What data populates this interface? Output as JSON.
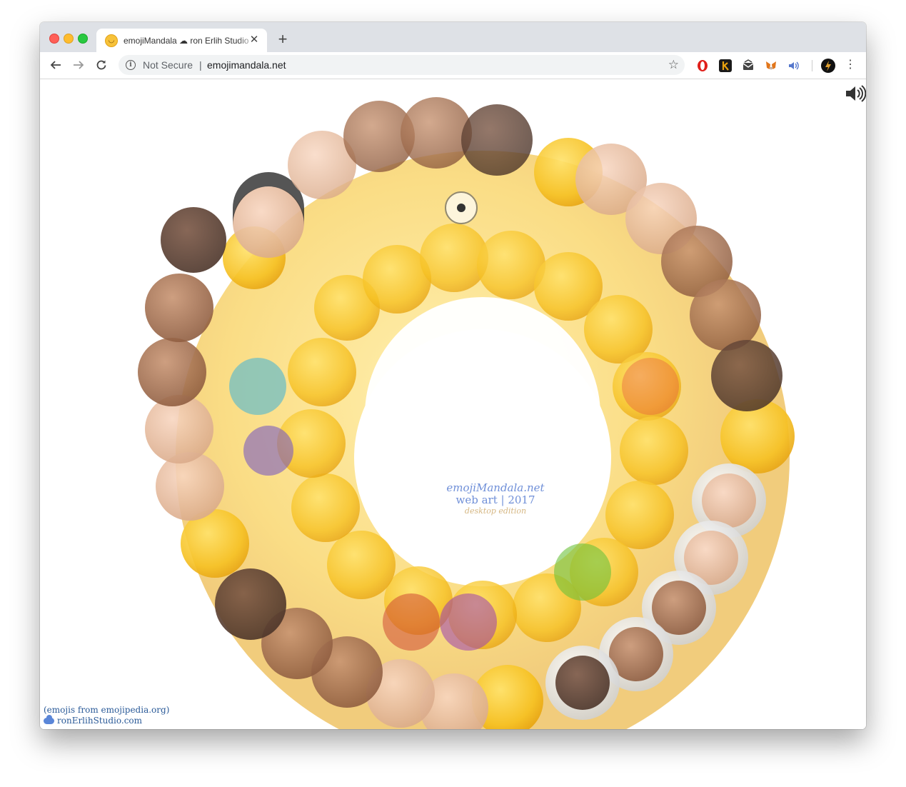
{
  "browser": {
    "tab": {
      "title": "emojiMandala ☁ ron Erlih Studio",
      "favicon": "smiling-face-icon",
      "close_glyph": "✕"
    },
    "new_tab_glyph": "+",
    "omnibox": {
      "security_label": "Not Secure",
      "separator": "|",
      "url": "emojimandala.net"
    },
    "toolbar_icons": [
      "back-arrow-icon",
      "forward-arrow-icon",
      "reload-icon",
      "info-icon",
      "bookmark-star-icon"
    ],
    "extensions": [
      "opera-icon",
      "k-extension-icon",
      "mail-extension-icon",
      "metamask-fox-icon",
      "sound-extension-icon"
    ],
    "menu_glyph": "⋮"
  },
  "page": {
    "credit": {
      "line1": "emojiMandala.net",
      "line2": "web art | 2017",
      "line3": "desktop edition"
    },
    "footer": {
      "source": "(emojis from emojipedia.org)",
      "studio_link": "ronErlihStudio.com"
    },
    "sound_icon": "speaker-icon",
    "colors": {
      "credit_text": "#6f8fd8",
      "link_text": "#2a5a98",
      "emoji_yellow": "#f8c92e"
    }
  }
}
